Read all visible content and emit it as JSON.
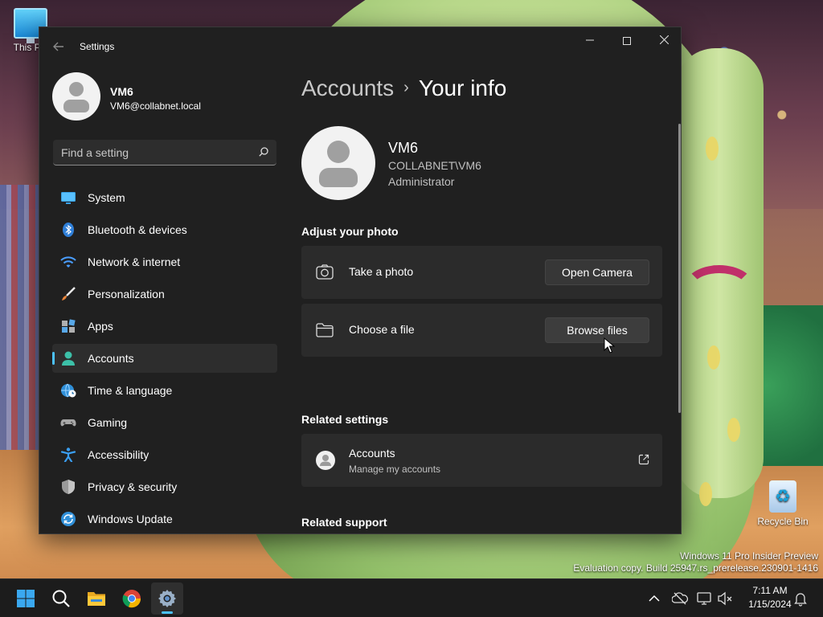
{
  "desktop": {
    "icons": [
      {
        "label": "This PC"
      },
      {
        "label": "Recycle Bin"
      }
    ],
    "watermark": {
      "line1": "Windows 11 Pro Insider Preview",
      "line2": "Evaluation copy. Build 25947.rs_prerelease.230901-1416"
    }
  },
  "window": {
    "title": "Settings",
    "controls": {
      "minimize": "minimize",
      "maximize": "maximize",
      "close": "close"
    }
  },
  "profile": {
    "name": "VM6",
    "email": "VM6@collabnet.local"
  },
  "search": {
    "placeholder": "Find a setting"
  },
  "nav": {
    "items": [
      {
        "label": "System",
        "icon": "monitor-icon"
      },
      {
        "label": "Bluetooth & devices",
        "icon": "bluetooth-icon"
      },
      {
        "label": "Network & internet",
        "icon": "wifi-icon"
      },
      {
        "label": "Personalization",
        "icon": "paintbrush-icon"
      },
      {
        "label": "Apps",
        "icon": "apps-icon"
      },
      {
        "label": "Accounts",
        "icon": "person-icon",
        "active": true
      },
      {
        "label": "Time & language",
        "icon": "globe-clock-icon"
      },
      {
        "label": "Gaming",
        "icon": "gamepad-icon"
      },
      {
        "label": "Accessibility",
        "icon": "accessibility-icon"
      },
      {
        "label": "Privacy & security",
        "icon": "shield-icon"
      },
      {
        "label": "Windows Update",
        "icon": "update-icon"
      }
    ]
  },
  "main": {
    "breadcrumb": {
      "parent": "Accounts",
      "separator": "›",
      "current": "Your info"
    },
    "user": {
      "name": "VM6",
      "domain": "COLLABNET\\VM6",
      "role": "Administrator"
    },
    "adjust_photo": {
      "title": "Adjust your photo",
      "take_photo": {
        "label": "Take a photo",
        "button": "Open Camera"
      },
      "choose_file": {
        "label": "Choose a file",
        "button": "Browse files"
      }
    },
    "related_settings": {
      "title": "Related settings",
      "accounts": {
        "label": "Accounts",
        "sub": "Manage my accounts"
      }
    },
    "related_support": {
      "title": "Related support"
    }
  },
  "taskbar": {
    "clock": {
      "time": "7:11 AM",
      "date": "1/15/2024"
    }
  },
  "colors": {
    "accent": "#4cc2ff",
    "window_bg": "#202020",
    "card_bg": "#2b2b2b"
  }
}
